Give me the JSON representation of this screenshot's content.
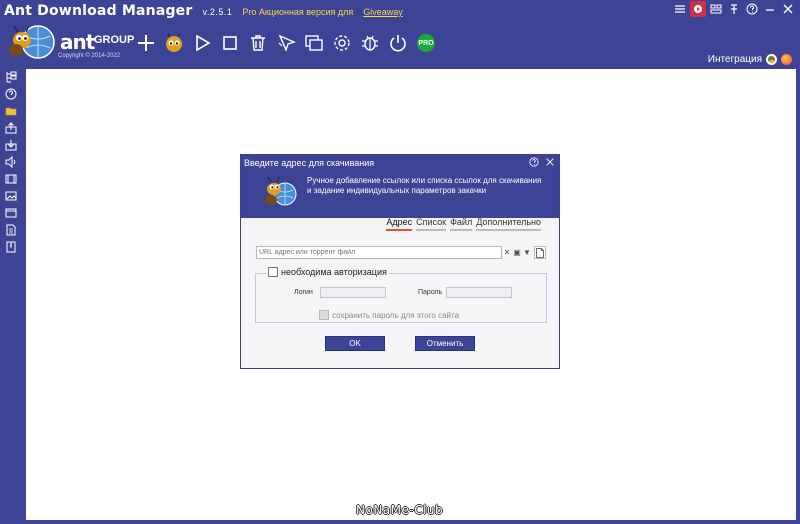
{
  "window": {
    "app_name": "Ant Download Manager",
    "version": "v.2.5.1",
    "promo": "Pro Акционная версия для",
    "promo_link": "Giveaway"
  },
  "logo": {
    "ant": "ant",
    "group": "GROUP",
    "copyright": "Copyright © 2014-2022"
  },
  "integration_label": "Интеграция",
  "watermark": "NoNaMe-Club",
  "colors": {
    "accent": "#3d4496",
    "tab_underline": "#e0542a",
    "pro": "#19a83c",
    "record": "#d0304a"
  },
  "dialog": {
    "title": "Введите адрес для скачивания",
    "description": "Ручное добавление ссылок или списка ссылок для скачивания и задание индивидуальных параметров закачки",
    "tabs": [
      {
        "label": "Адрес"
      },
      {
        "label": "Список"
      },
      {
        "label": "Файл"
      },
      {
        "label": "Дополнительно"
      }
    ],
    "url_placeholder": "URL адрес или торрент файл",
    "auth_label": "необходима авторизация",
    "login_label": "Логин",
    "password_label": "Пароль",
    "save_password_label": "сохранить пароль для этого сайта",
    "ok_label": "OK",
    "cancel_label": "Отменить"
  },
  "badges": {
    "pro": "PRO"
  }
}
